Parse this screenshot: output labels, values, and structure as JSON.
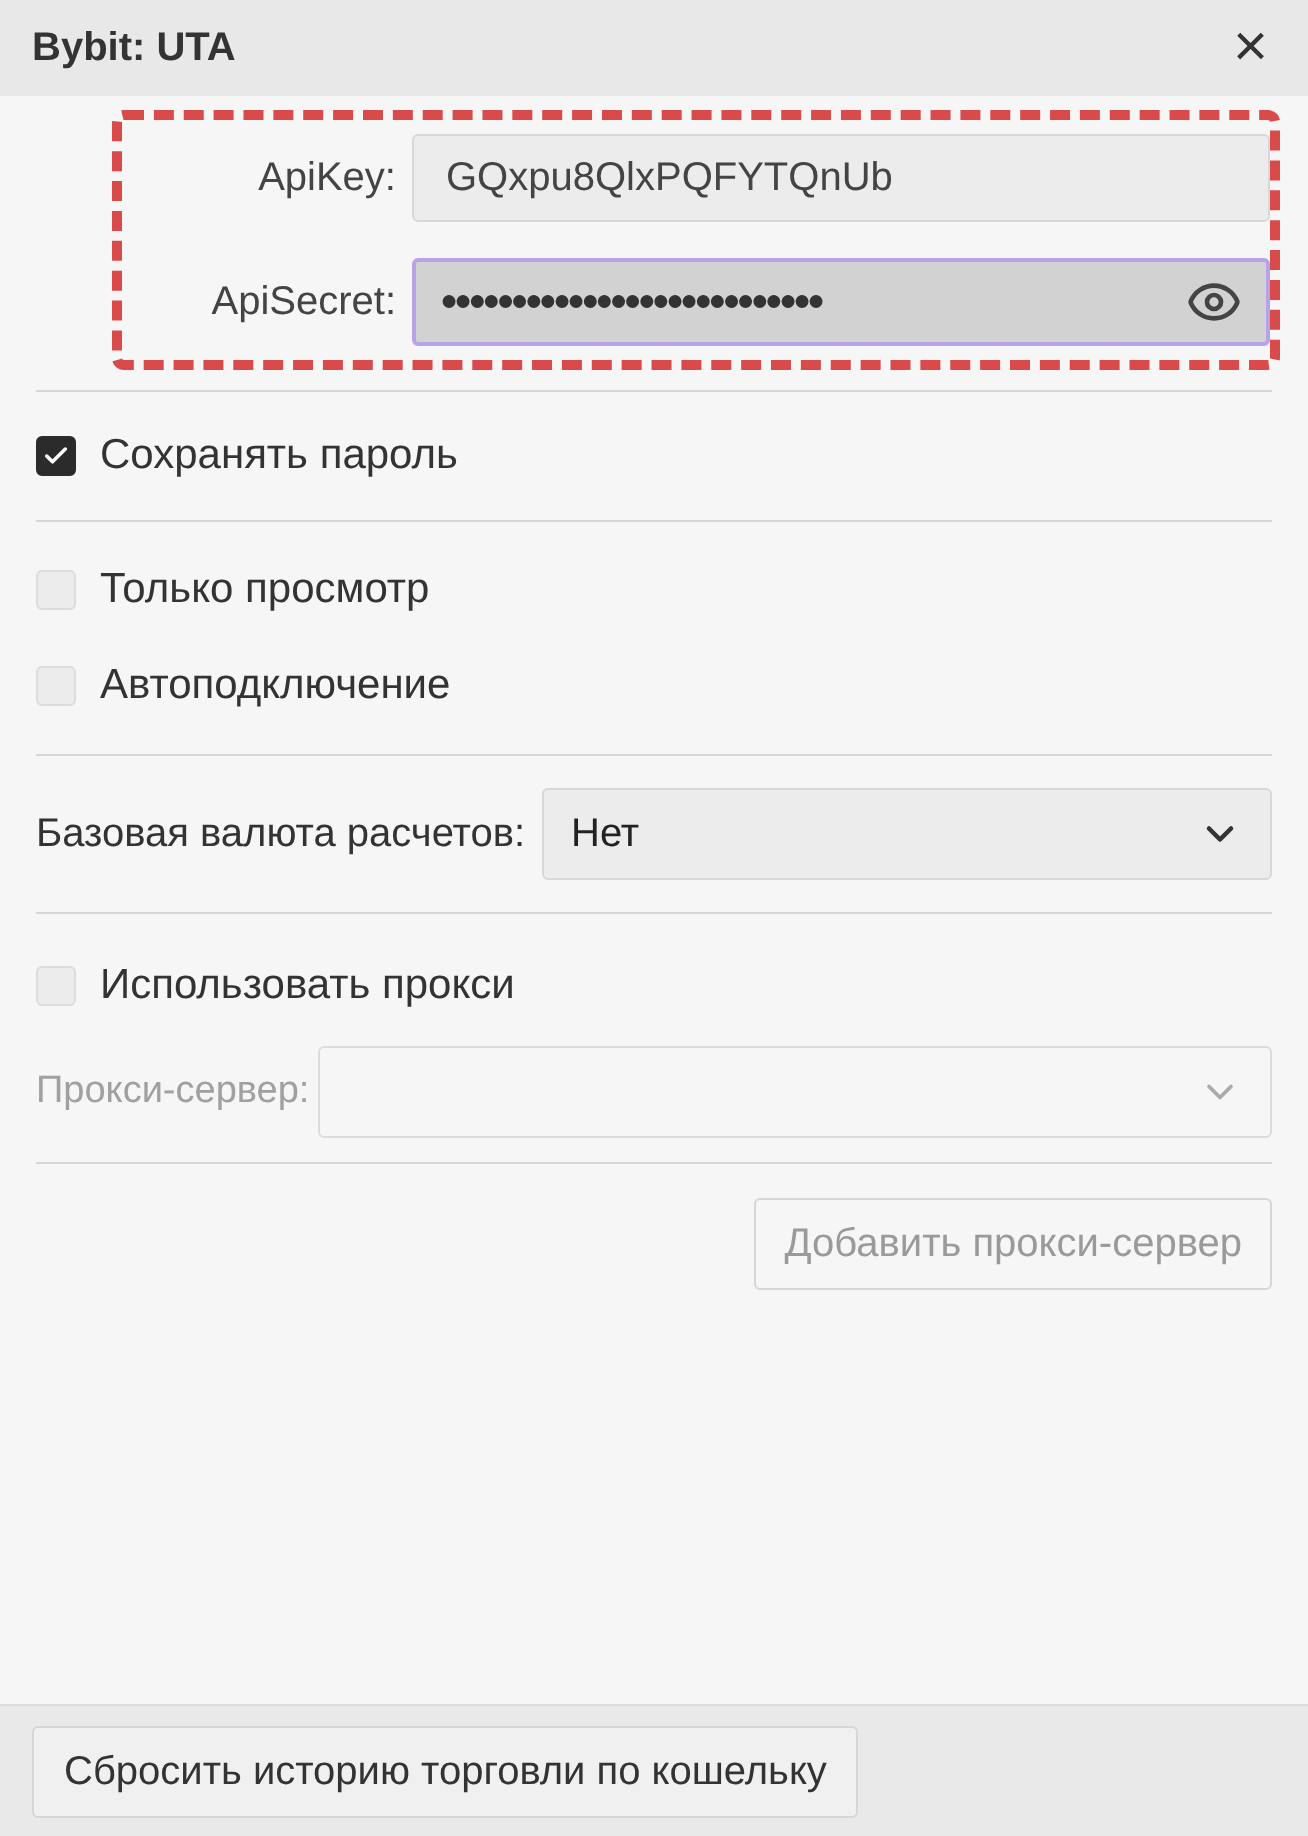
{
  "window": {
    "title": "Bybit: UTA",
    "close": "×"
  },
  "credentials": {
    "highlighted": true,
    "api_key": {
      "label": "ApiKey:",
      "value": "GQxpu8QlxPQFYTQnUb"
    },
    "api_secret": {
      "label": "ApiSecret:",
      "masked_value": "●●●●●●●●●●●●●●●●●●●●●●●●●●●",
      "focused": true
    }
  },
  "save_password": {
    "label": "Сохранять пароль",
    "checked": true
  },
  "options": [
    {
      "label": "Только просмотр",
      "checked": false
    },
    {
      "label": "Автоподключение",
      "checked": false
    }
  ],
  "base_currency": {
    "label": "Базовая валюта расчетов:",
    "value": "Нет"
  },
  "use_proxy": {
    "label": "Использовать прокси",
    "checked": false
  },
  "proxy_server": {
    "label": "Прокси-сервер:",
    "disabled": true
  },
  "add_proxy_button": {
    "label": "Добавить прокси-сервер",
    "disabled": true
  },
  "footer": {
    "reset_button": "Сбросить историю торговли по кошельку"
  }
}
